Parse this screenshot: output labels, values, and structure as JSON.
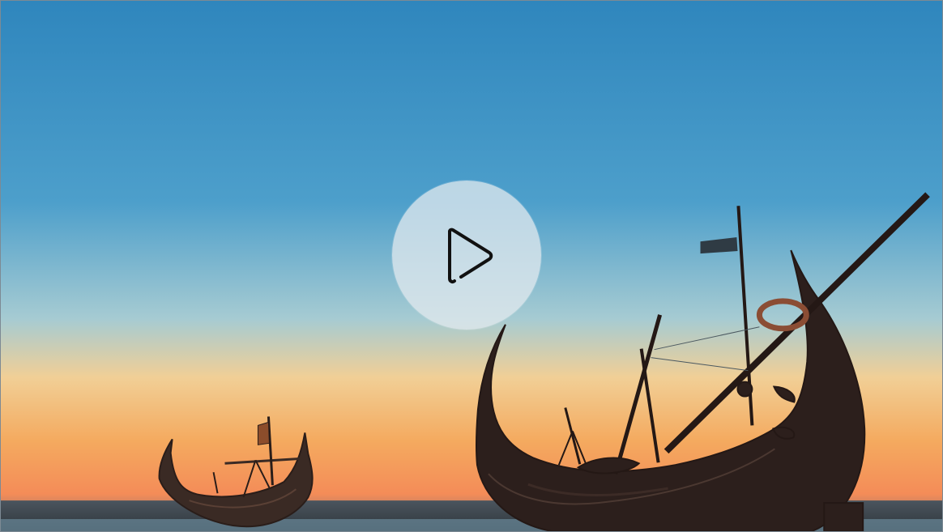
{
  "video_player": {
    "play_label": "",
    "scene": "boat-silhouettes-at-sunset"
  },
  "icons": {
    "play": "play-icon"
  },
  "colors": {
    "sky_top": "#2f88bd",
    "sky_mid": "#7bb9d2",
    "horizon": "#f2a05c",
    "water": "#52606a",
    "play_button": "#e1e8ee",
    "silhouette": "#2b1f1c"
  }
}
